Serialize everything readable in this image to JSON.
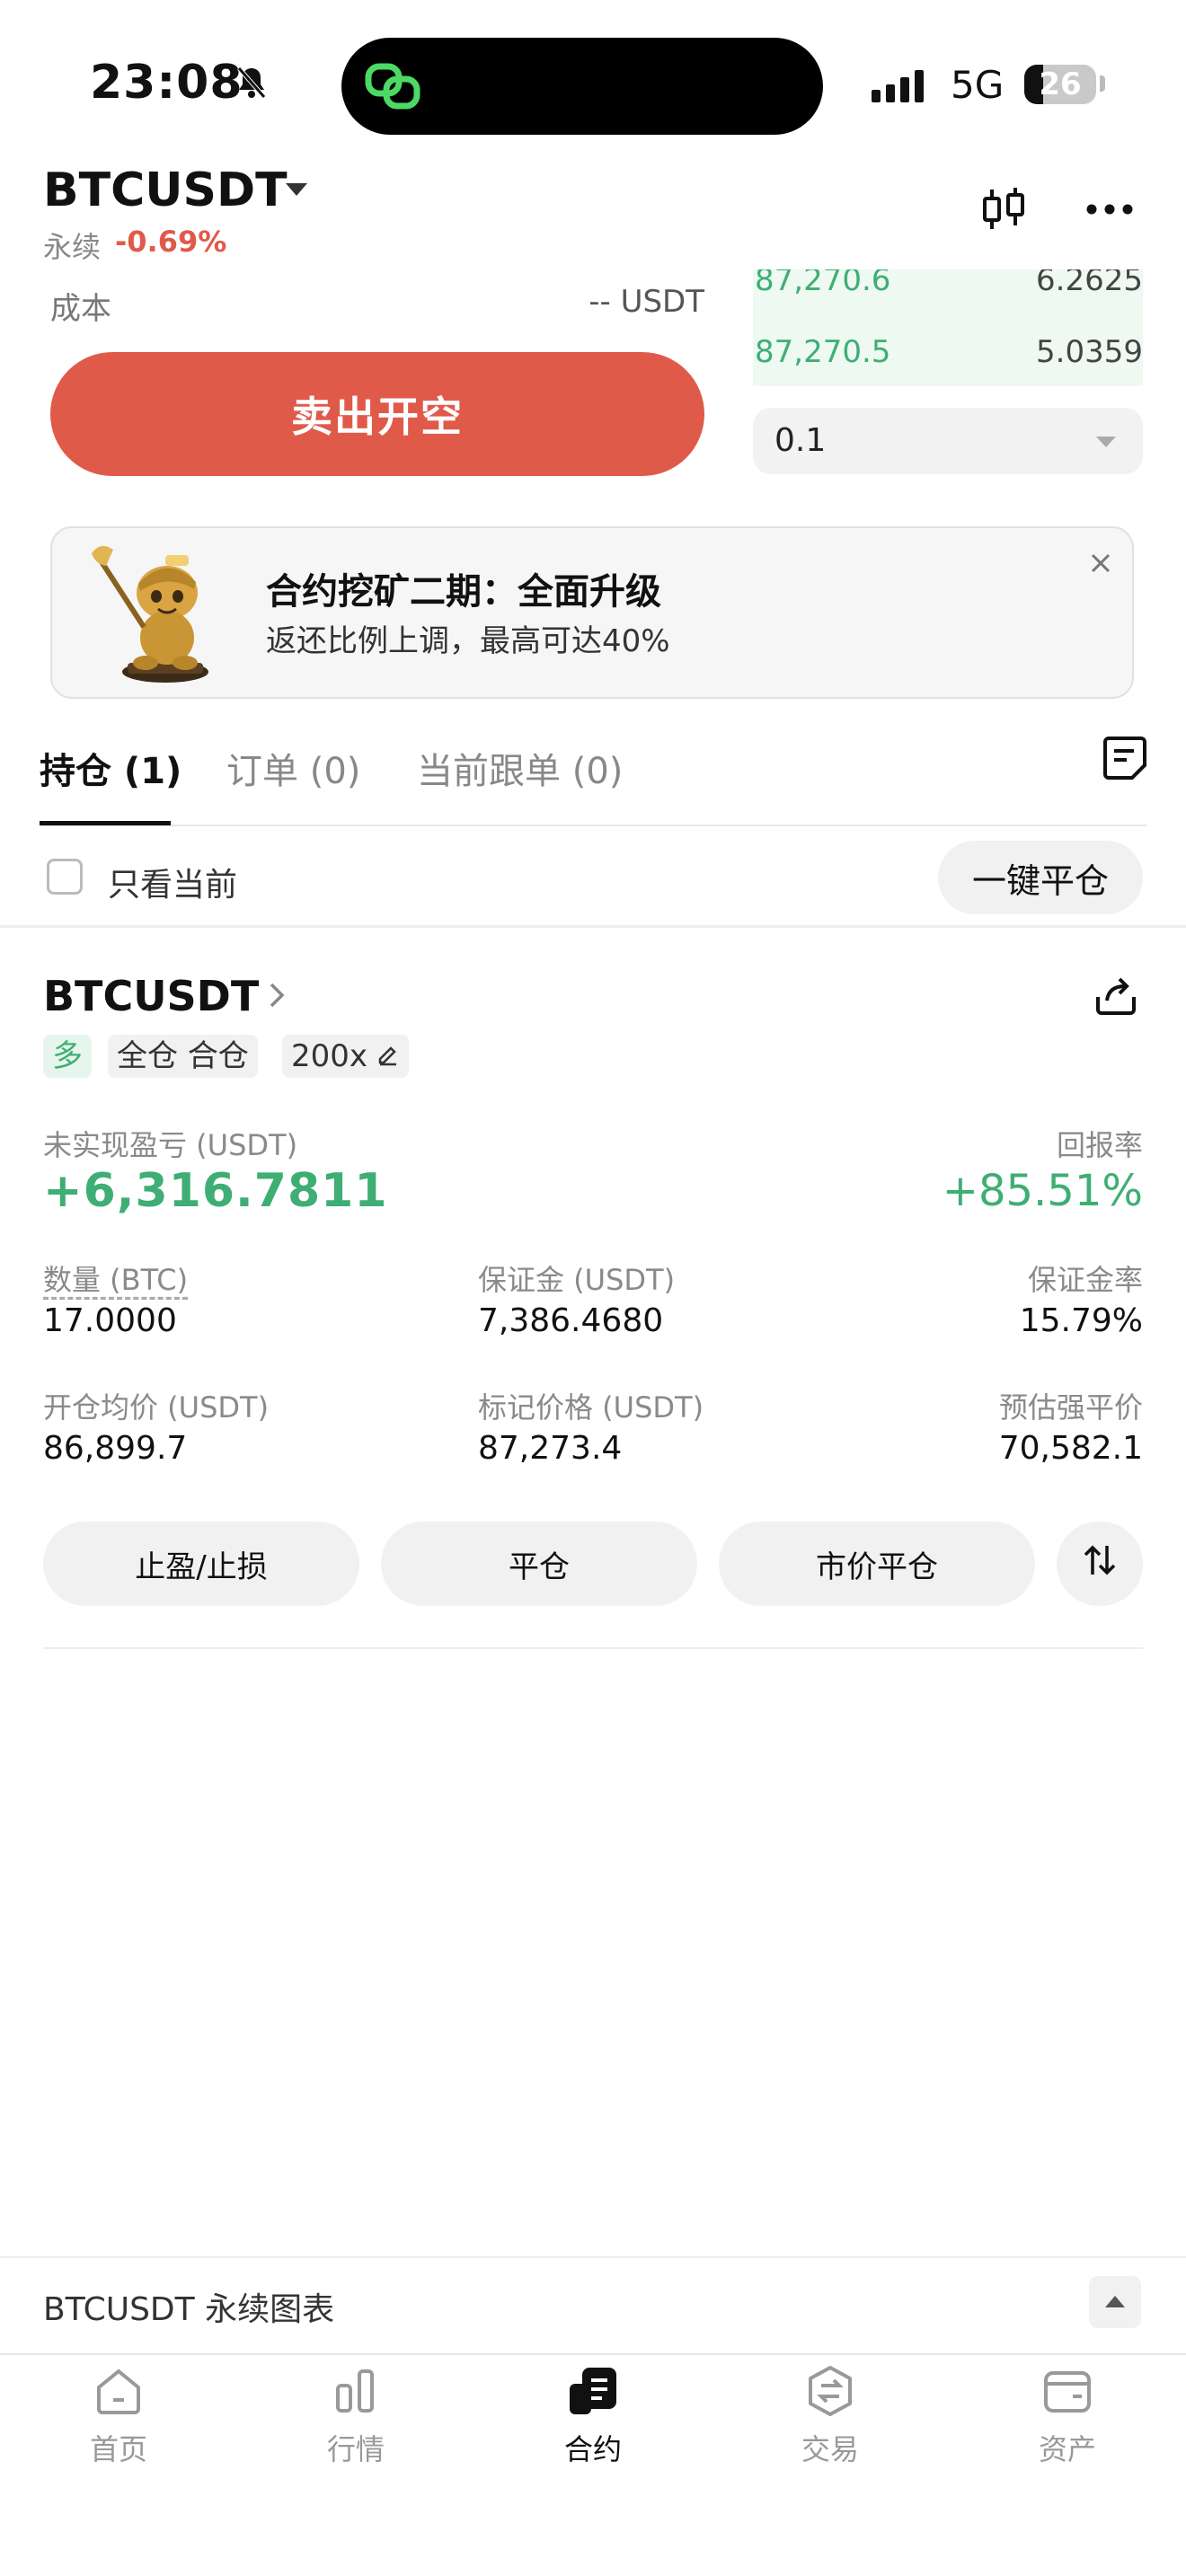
{
  "status_bar": {
    "time": "23:08",
    "network": "5G",
    "battery": "26",
    "battery_level": 0.26
  },
  "header": {
    "symbol": "BTCUSDT",
    "type_label": "永续",
    "change": "-0.69%"
  },
  "trade_panel": {
    "cost_label": "成本",
    "cost_value": "-- USDT",
    "sell_button": "卖出开空",
    "orderbook": [
      {
        "price": "87,270.6",
        "size": "6.2625"
      },
      {
        "price": "87,270.5",
        "size": "5.0359"
      }
    ],
    "quantity_select": "0.1"
  },
  "banner": {
    "title": "合约挖矿二期：全面升级",
    "subtitle": "返还比例上调，最高可达40%",
    "close": "×"
  },
  "tabs": [
    {
      "label": "持仓 (1)"
    },
    {
      "label": "订单 (0)"
    },
    {
      "label": "当前跟单 (0)"
    }
  ],
  "filter": {
    "only_current": "只看当前",
    "close_all": "一键平仓"
  },
  "position": {
    "symbol": "BTCUSDT",
    "tags": {
      "side": "多",
      "mode": "全仓 合仓",
      "leverage": "200x"
    },
    "unrealized_pnl_label": "未实现盈亏 (USDT)",
    "unrealized_pnl": "+6,316.7811",
    "roe_label": "回报率",
    "roe": "+85.51%",
    "quantity_label": "数量 (BTC)",
    "quantity": "17.0000",
    "margin_label": "保证金 (USDT)",
    "margin": "7,386.4680",
    "margin_ratio_label": "保证金率",
    "margin_ratio": "15.79%",
    "entry_label": "开仓均价 (USDT)",
    "entry": "86,899.7",
    "mark_label": "标记价格 (USDT)",
    "mark": "87,273.4",
    "liq_label": "预估强平价",
    "liq": "70,582.1",
    "actions": {
      "tpsl": "止盈/止损",
      "close": "平仓",
      "market_close": "市价平仓"
    }
  },
  "chart_bar": {
    "label": "BTCUSDT 永续图表"
  },
  "nav": [
    {
      "label": "首页",
      "icon": "home-icon"
    },
    {
      "label": "行情",
      "icon": "market-icon"
    },
    {
      "label": "合约",
      "icon": "futures-icon"
    },
    {
      "label": "交易",
      "icon": "trade-icon"
    },
    {
      "label": "资产",
      "icon": "wallet-icon"
    }
  ],
  "colors": {
    "accent_red": "#e05a4a",
    "accent_green": "#3fae74"
  }
}
